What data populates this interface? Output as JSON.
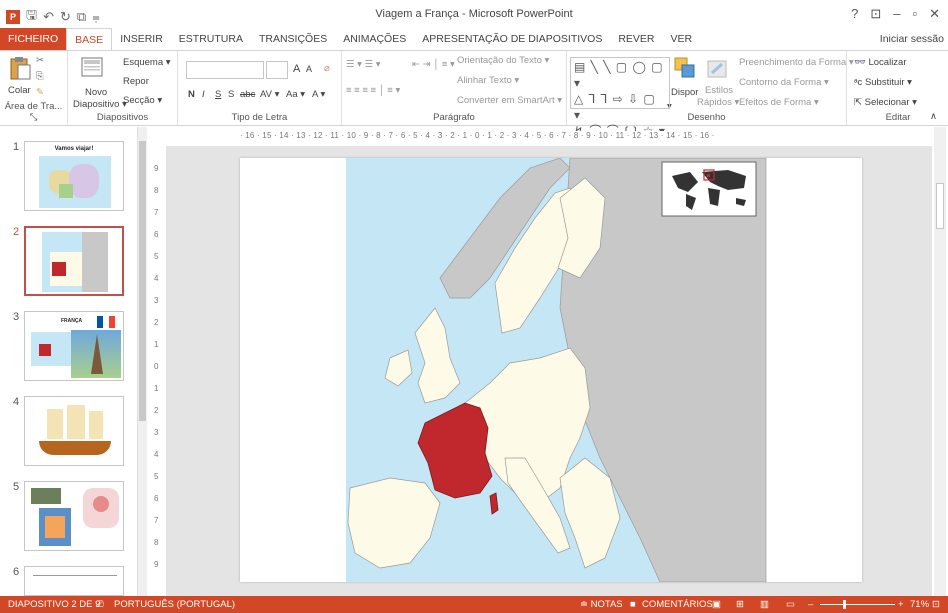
{
  "window": {
    "title": "Viagem a França - Microsoft PowerPoint",
    "help": "?",
    "ribbon_display": "⊡",
    "minimize": "–",
    "restore": "▫",
    "close": "✕",
    "sign_in": "Iniciar sessão"
  },
  "tabs": [
    "FICHEIRO",
    "BASE",
    "INSERIR",
    "ESTRUTURA",
    "TRANSIÇÕES",
    "ANIMAÇÕES",
    "APRESENTAÇÃO DE DIAPOSITIVOS",
    "REVER",
    "VER"
  ],
  "ribbon": {
    "clipboard": {
      "paste": "Colar",
      "label": "Área de Tra... ⤡"
    },
    "slides": {
      "new_slide": "Novo",
      "new_slide2": "Diapositivo ▾",
      "layout": "Esquema ▾",
      "reset": "Repor",
      "section": "Secção ▾",
      "label": "Diapositivos"
    },
    "font": {
      "label": "Tipo de Letra",
      "bold": "N",
      "italic": "I",
      "underline": "S",
      "strike": "S",
      "abc": "abc",
      "spacing": "AV ▾",
      "case": "Aa ▾",
      "color": "A ▾",
      "grow": "A",
      "shrink": "A"
    },
    "paragraph": {
      "text_direction": "Orientação do Texto ▾",
      "align_text": "Alinhar Texto ▾",
      "smartart": "Converter em SmartArt ▾",
      "label": "Parágrafo"
    },
    "drawing": {
      "arrange": "Dispor",
      "quick_styles": "Estilos",
      "quick_styles2": "Rápidos ▾",
      "fill": "Preenchimento da Forma ▾",
      "outline": "Contorno da Forma ▾",
      "effects": "Efeitos de Forma ▾",
      "label": "Desenho"
    },
    "editing": {
      "find": "Localizar",
      "replace": "Substituir ▾",
      "select": "Selecionar ▾",
      "label": "Editar"
    }
  },
  "thumbnails": [
    {
      "num": "1",
      "title": "Vamos viajar!"
    },
    {
      "num": "2",
      "title": ""
    },
    {
      "num": "3",
      "title": "FRANÇA"
    },
    {
      "num": "4",
      "title": ""
    },
    {
      "num": "5",
      "title": ""
    },
    {
      "num": "6",
      "title": ""
    }
  ],
  "ruler": {
    "horizontal": "· 16 · 15 · 14 · 13 · 12 · 11 · 10 · 9 · 8 · 7 · 6 · 5 · 4 · 3 · 2 · 1 · 0 · 1 · 2 · 3 · 4 · 5 · 6 · 7 · 8 · 9 · 10 · 11 · 12 · 13 · 14 · 15 · 16 ·",
    "vertical": [
      "9",
      "8",
      "7",
      "6",
      "5",
      "4",
      "3",
      "2",
      "1",
      "0",
      "1",
      "2",
      "3",
      "4",
      "5",
      "6",
      "7",
      "8",
      "9"
    ]
  },
  "status": {
    "slide": "DIAPOSITIVO 2 DE 9",
    "language": "PORTUGUÊS (PORTUGAL)",
    "notes": "≐ NOTAS",
    "comments": "COMENTÁRIOS",
    "zoom": "71%"
  },
  "colors": {
    "accent": "#d24726",
    "france": "#c0282d",
    "eu_land": "#fdfbe7",
    "non_eu_land": "#c8c8c8",
    "sea": "#c5e6f4"
  }
}
